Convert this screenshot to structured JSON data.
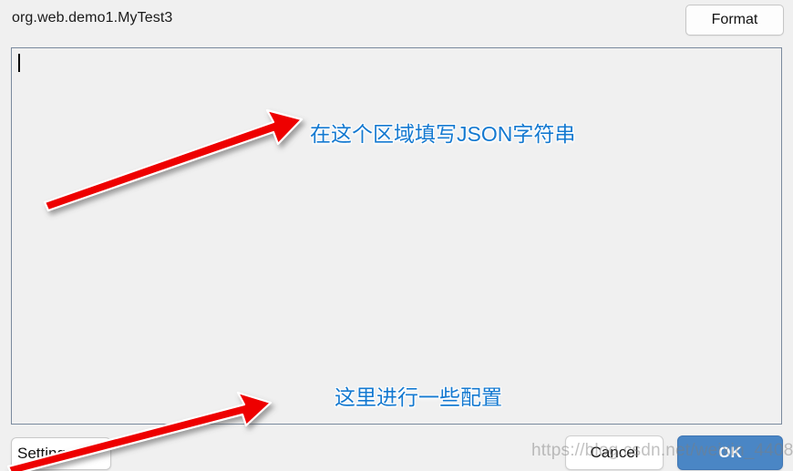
{
  "header": {
    "title": "org.web.demo1.MyTest3",
    "format_label": "Format"
  },
  "editor": {
    "value": "",
    "placeholder": ""
  },
  "footer": {
    "setting_label": "Setting",
    "cancel_label": "Cancel",
    "ok_label": "OK"
  },
  "annotations": {
    "json_area_note": "在这个区域填写JSON字符串",
    "config_note": "这里进行一些配置",
    "arrow_color": "#ee0000",
    "text_color": "#1479d0"
  },
  "watermark": {
    "text": "https://blog.csdn.net/weixin_44082647"
  },
  "colors": {
    "background": "#f0f0f0",
    "textarea_border": "#7a8a9e",
    "ok_button_bg": "#4a86c5",
    "button_border": "#c6c6c6"
  }
}
